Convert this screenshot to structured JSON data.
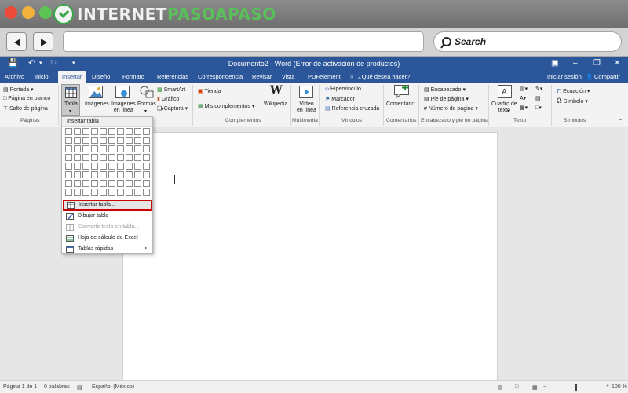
{
  "browser": {
    "logo_text_a": "INTERNET",
    "logo_text_b": "PASOAPASO",
    "search_label": "Search",
    "address_value": ""
  },
  "word": {
    "title": "Documento2 - Word (Error de activación de productos)",
    "tabs": [
      "Archivo",
      "Inicio",
      "Insertar",
      "Diseño",
      "Formato",
      "Referencias",
      "Correspondencia",
      "Revisar",
      "Vista",
      "PDFelement"
    ],
    "tell_me": "¿Qué desea hacer?",
    "sign_in": "Iniciar sesión",
    "share": "Compartir",
    "active_tab": "Insertar"
  },
  "ribbon": {
    "paginas": {
      "portada": "Portada",
      "en_blanco": "Página en blanco",
      "salto": "Salto de página",
      "group": "Páginas"
    },
    "tabla": {
      "label": "Tabla"
    },
    "ilustraciones": {
      "imagenes": "Imágenes",
      "imagenes_linea_1": "Imágenes",
      "imagenes_linea_2": "en línea",
      "formas": "Formas",
      "smartart": "SmartArt",
      "grafico": "Gráfico",
      "captura": "Captura"
    },
    "complementos": {
      "tienda": "Tienda",
      "mis": "Mis complementos",
      "wikipedia": "Wikipedia",
      "group": "Complementos"
    },
    "multimedia": {
      "video_1": "Vídeo",
      "video_2": "en línea",
      "group": "Multimedia"
    },
    "vinculos": {
      "hipervinculo": "Hipervínculo",
      "marcador": "Marcador",
      "referencia": "Referencia cruzada",
      "group": "Vínculos"
    },
    "comentarios": {
      "comentario": "Comentario",
      "group": "Comentarios"
    },
    "encabezado": {
      "encabezado": "Encabezado",
      "pie": "Pie de página",
      "numero": "Número de página",
      "group": "Encabezado y pie de página"
    },
    "texto": {
      "cuadro_1": "Cuadro de",
      "cuadro_2": "texto",
      "group": "Texto"
    },
    "simbolos": {
      "ecuacion": "Ecuación",
      "simbolo": "Símbolo",
      "group": "Símbolos"
    }
  },
  "menu": {
    "title": "Insertar tabla",
    "items": [
      {
        "label": "Insertar tabla...",
        "enabled": true
      },
      {
        "label": "Dibujar tabla",
        "enabled": true
      },
      {
        "label": "Convertir texto en tabla...",
        "enabled": false
      },
      {
        "label": "Hoja de cálculo de Excel",
        "enabled": true
      },
      {
        "label": "Tablas rápidas",
        "enabled": true
      }
    ],
    "grid": {
      "cols": 10,
      "rows": 8
    }
  },
  "status": {
    "page": "Página 1 de 1",
    "words": "0 palabras",
    "language": "Español (México)",
    "zoom": "100 %"
  },
  "colors": {
    "word_blue": "#2b579a",
    "highlight": "#cc0000"
  }
}
